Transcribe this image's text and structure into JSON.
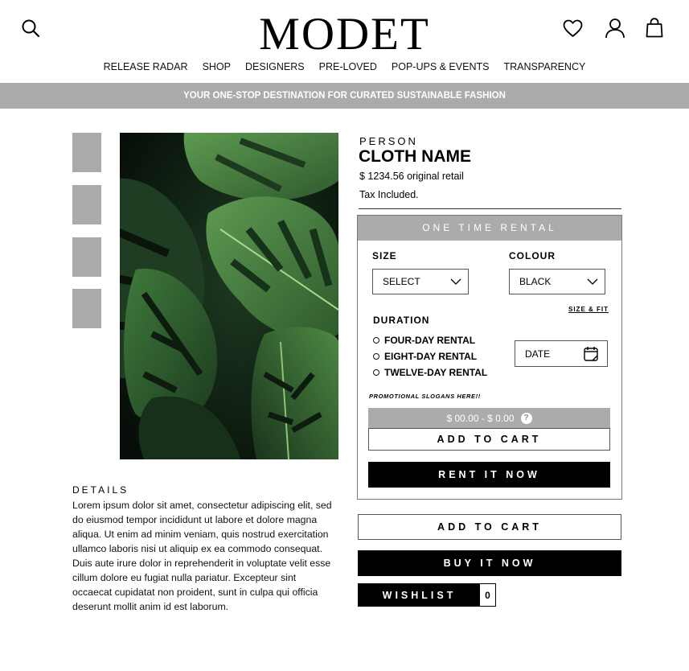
{
  "header": {
    "logo": "MODET",
    "icons": {
      "search": "search-icon",
      "wishlist": "heart-icon",
      "account": "user-icon",
      "cart": "shopping-bag-icon"
    },
    "nav": [
      "RELEASE RADAR",
      "SHOP",
      "DESIGNERS",
      "PRE-LOVED",
      "POP-UPS & EVENTS",
      "TRANSPARENCY"
    ]
  },
  "banner": {
    "text": "YOUR ONE-STOP DESTINATION FOR CURATED SUSTAINABLE FASHION"
  },
  "gallery": {
    "thumbnail_count": 4,
    "main_image": "monstera-leaves-photo"
  },
  "details": {
    "title": "DETAILS",
    "body": "Lorem ipsum dolor sit amet, consectetur adipiscing elit, sed do eiusmod tempor incididunt ut labore et dolore magna aliqua. Ut enim ad minim veniam, quis nostrud exercitation ullamco laboris nisi ut aliquip ex ea commodo consequat. Duis aute irure dolor in reprehenderit in voluptate velit esse cillum dolore eu fugiat nulla pariatur. Excepteur sint occaecat cupidatat non proident, sunt in culpa qui officia deserunt mollit anim id est laborum."
  },
  "product": {
    "brand": "PERSON",
    "name": "CLOTH NAME",
    "price": "$ 1234.56 original retail",
    "tax": "Tax Included."
  },
  "rental": {
    "header": "ONE TIME RENTAL",
    "size_label": "SIZE",
    "size_value": "SELECT",
    "colour_label": "COLOUR",
    "colour_value": "BLACK",
    "size_fit_link": "SIZE & FIT",
    "duration_label": "DURATION",
    "durations": [
      "FOUR-DAY RENTAL",
      "EIGHT-DAY RENTAL",
      "TWELVE-DAY RENTAL"
    ],
    "date_placeholder": "DATE",
    "promo": "PROMOTIONAL SLOGANS HERE!!",
    "price_range": "$ 00.00 - $ 0.00",
    "help_badge": "?",
    "add_to_cart": "ADD TO CART",
    "rent_now": "RENT IT NOW"
  },
  "purchase": {
    "add_to_cart": "ADD TO CART",
    "buy_now": "BUY IT NOW",
    "wishlist_label": "WISHLIST",
    "wishlist_count": "0"
  },
  "colors": {
    "grey": "#ababab",
    "black": "#000000",
    "white": "#ffffff"
  }
}
